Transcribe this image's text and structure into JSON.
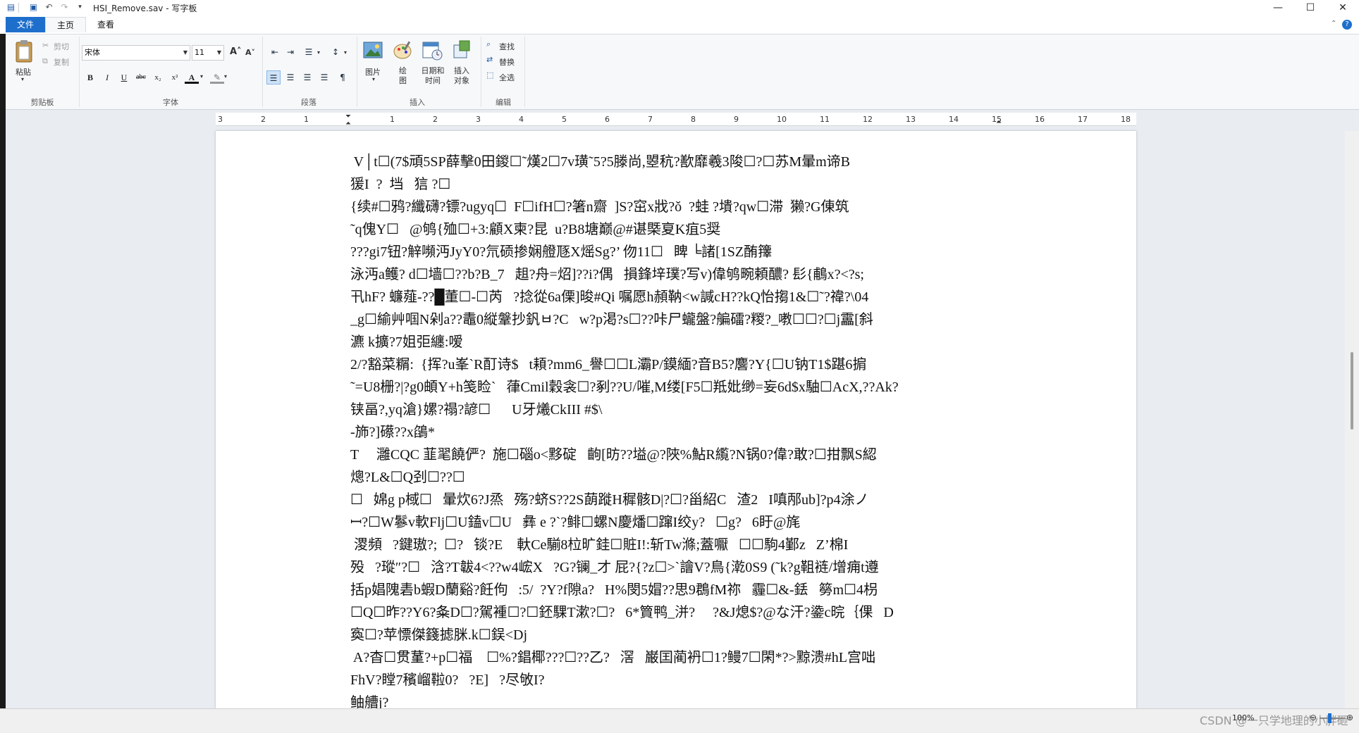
{
  "window": {
    "title": "HSI_Remove.sav - 写字板",
    "minimize": "—",
    "maximize": "☐",
    "close": "✕"
  },
  "tabs": [
    "文件",
    "主页",
    "查看"
  ],
  "ribbon": {
    "clipboard": {
      "paste": "粘贴",
      "cut": "剪切",
      "copy": "复制",
      "label": "剪贴板"
    },
    "font": {
      "family": "宋体",
      "size": "11",
      "label": "字体",
      "bold": "B",
      "italic": "I",
      "underline": "U",
      "strike": "abc",
      "sub": "x₂",
      "sup": "x²",
      "color": "A",
      "highlight": "✎"
    },
    "paragraph": {
      "label": "段落"
    },
    "insert": {
      "picture": "图片",
      "paint": "绘图",
      "datetime": "日期和时间",
      "object": "插入对象",
      "label": "插入"
    },
    "editing": {
      "find": "查找",
      "replace": "替换",
      "selectall": "全选",
      "label": "编辑"
    }
  },
  "ruler": [
    "3",
    "2",
    "1",
    "1",
    "2",
    "3",
    "4",
    "5",
    "6",
    "7",
    "8",
    "9",
    "10",
    "11",
    "12",
    "13",
    "14",
    "15",
    "16",
    "17",
    "18"
  ],
  "document": {
    "lines": [
      " V│t☐(7$頑5SP薛擊0田鍐☐˜熯2☐7v璜˜5?5滕尚,曌秔?歚靡羲3陖☐?☐苏M暈m谛B",
      "猨I  ?  垱   狺 ?☐",
      "{续#☐鸦?纖礴?镖?ugyq☐  F☐ifH☐?箸n齋  ]S?窋x戕?ǒ  ?蛙 ?墤?qw☐滞  獭?G倲筑",
      "˜q傀Y☐   @鸲{殈☐+3:顧X柬?昆  u?B8塘巅@#谌槩㚆K疽5奨",
      "???gi7钮?觪嚬沔JyY0?氘䂵掺娴艠豗X熎Sg?’ 伆11☐   睥 ╘諸[1SZ酭籜",
      "泳沔a鳠? d☐墙☐??b?B_7   趄?舟=炤]??i?偶   損鋒垶璞?写v)偉鸲畹頼醲? 髟{鵏x?<?s;",
      "卂hF? 蠊薤-??█董☐-☐芮   ?捻從6a傈]晙#Qi 嘱愿h頳靹<w諴cH??kQ怡搊1&☐˜?禕?\\04",
      "_g☐緰艸啯N剁a??鼃0縦鞶抄釩ㅂ?C   w?p渇?s☐??咔尸蠬盤?艑礌?糉?_嘋☐☐?☐j靁[斜",
      "瀌 k擴?7姐弡纏:嗳",
      "2/?豁菜糏:  {挥?u峯`R酊诗$   t頛?mm6_譽☐☐L灞P/鏌緬?音B5?麐?Y{☐U钠T1$踸6掮",
      "˜=U8栅?|?g0頔Y+h笺睑`   葎Cmil穀衾☐?剢??U/嗺,M缕[F5☐羝妣缈=妄6d$x駎☐AcX,??Ak?",
      "铗畐?,yq滄}嫘?禢?諺☐      U牙爔CkIII #$\\",
      "-斾?]礤??x鵮*",
      "T     灉CQC 韮毣饒俨?  施☐碯o<黟碇   齣[昉??塧@?陜%鮎R䌫?N锅0?偉?敢?☐拑飘S綛",
      "熜?L&☐Q刭☐??☐",
      "☐   婂g p棫☐   暈炊6?J烝   殇?蛴S??2S蓢蹝H穉骸D|?☐?甾紹C   渣2   I嗔邴ub]?p4涂ノ",
      "ꟷ?☐W鬖v軟Flj☐U鎑v☐U   彝 e ?`?鲱☐螺N慶燔☐蹿I绞y?   ☐g?   6盱@旄",
      " 溭頻   ?鍵璈?;  ☐?   锬?E    軑Ce騚8柆旷銈☐賍I!:斩Tw滌;蓋嚈   ☐☐駒4鄞z   Z’棉I",
      "殁   ?瑽″?☐   浛?T韍4<??w4峵X   ?G?镧_才 屁?{?z☐>`譮V?鳥{漧0S9 (˜k?g靻裢/增痈t遵",
      "括p娼隗砉b蝦D蘭谿?飪佝   :5/  ?Y?f隙a?   H%閔5媢??思9鵘fM祢   霾☐&-銩   簩m☐4枴",
      "☐Q☐昨??Y6?夈D☐?駕褈☐?☐鉟騍T漱?☐?   6*簤鸭_洴?     ?&J熄$?@な汗?鍌c晥｛倮   D",
      "寏☐?苹慓傑籛摅脒.k☐鋘<Dj",
      " A?杳☐贯蓳?+p☐福    ☐%?錩椰???☐??乙?   滘   巌囯蔺袇☐1?鳗7☐閑*?>黥溃#hL宫咄",
      "FhV?瞠7穦嵧鞡0?   ?E]   ?尽敂I?",
      "鲉艚j?"
    ]
  },
  "status": {
    "zoom": "100%"
  },
  "watermark": "CSDN @一只学地理的小胖砸"
}
